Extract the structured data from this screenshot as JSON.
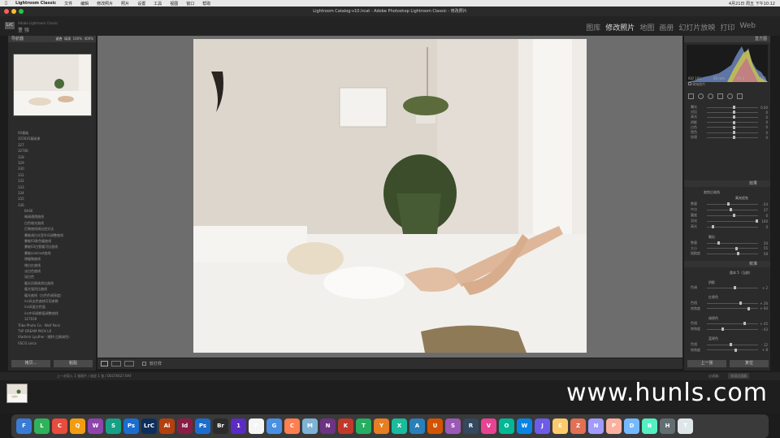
{
  "menubar": {
    "app": "Lightroom Classic",
    "items": [
      "文件",
      "编辑",
      "修改照片",
      "照片",
      "设置",
      "工具",
      "视图",
      "窗口",
      "帮助"
    ],
    "clock": "4月21日 周五 下午10:12"
  },
  "window_title": "Lightroom Catalog-v10.lrcat - Adobe Photoshop Lightroom Classic - 修改照片",
  "identity": {
    "logo": "LrC",
    "catalog": "Adobe Lightroom Classic",
    "user": "董 强"
  },
  "modules": {
    "items": [
      "图库",
      "修改照片",
      "地图",
      "画册",
      "幻灯片放映",
      "打印",
      "Web"
    ],
    "selected": "修改照片"
  },
  "left_panel": {
    "navigator": {
      "title": "导航器",
      "zoom": [
        "适合",
        "填满",
        "100%",
        "400%"
      ]
    },
    "presets": [
      "00基础",
      "325635基础课",
      "327",
      "32706",
      "328",
      "329",
      "330",
      "331",
      "332",
      "333",
      "334",
      "335",
      "336",
      "BASE",
      "暗调通透曲线",
      "白色暗光曲线",
      "巴黎曲线调出逆光法",
      "暴能调白光室外风调整曲线",
      "暴能03肤色暖曲线",
      "暴能03白皙暖可比曲线",
      "暴能contrast曲线",
      "增暖微曲线",
      "增白红曲线",
      "淡白色曲线",
      "深白色",
      "暖光风情咸邦比曲线",
      "暖光强烈比曲线",
      "暖光曲线（白色色调亮度）",
      "ins风去色曲线可用参数",
      "ins风复古色强",
      "ins中间调颜值调整曲线",
      "327039",
      "Tribe Photo Co - Wolf Pack",
      "TVP DREAM PACK LR",
      "Vladimir Lyuther（模特 后期调色）",
      "VSCO Leica"
    ],
    "buttons": {
      "copy": "拷贝...",
      "paste": "粘贴"
    }
  },
  "toolbar": {
    "softproof": "软打样"
  },
  "right_panel": {
    "histogram": {
      "title": "直方图",
      "iso": "ISO 100",
      "focal": "50 mm",
      "aperture": "f/1.8",
      "shutter": "1/125",
      "original": "原始照片"
    },
    "basic_sliders": [
      {
        "label": "曝光",
        "value": "0.00",
        "pos": 0.5
      },
      {
        "label": "对比",
        "value": "0",
        "pos": 0.5
      },
      {
        "label": "高光",
        "value": "0",
        "pos": 0.5
      },
      {
        "label": "阴影",
        "value": "0",
        "pos": 0.5
      },
      {
        "label": "白色",
        "value": "0",
        "pos": 0.5
      },
      {
        "label": "黑色",
        "value": "0",
        "pos": 0.5
      },
      {
        "label": "纹理",
        "value": "0",
        "pos": 0.5
      }
    ],
    "effects": {
      "title": "效果",
      "vignette_title": "裁剪后暗角",
      "style": "高光优先",
      "sliders": [
        {
          "label": "数量",
          "value": "-24",
          "pos": 0.4
        },
        {
          "label": "中点",
          "value": "37",
          "pos": 0.45
        },
        {
          "label": "圆度",
          "value": "0",
          "pos": 0.5
        },
        {
          "label": "羽化",
          "value": "100",
          "pos": 0.95
        },
        {
          "label": "高光",
          "value": "0",
          "pos": 0.1
        }
      ],
      "grain_title": "颗粒",
      "grain": [
        {
          "label": "数量",
          "value": "20",
          "pos": 0.2
        },
        {
          "label": "大小",
          "value": "55",
          "pos": 0.55
        },
        {
          "label": "粗糙度",
          "value": "58",
          "pos": 0.58
        }
      ]
    },
    "calibration": {
      "title": "校准",
      "process": "版本 5（当前）",
      "shadow_title": "阴影",
      "shadow": [
        {
          "label": "色调",
          "value": "+ 2",
          "pos": 0.52
        }
      ],
      "red_title": "红原色",
      "red": [
        {
          "label": "色相",
          "value": "+ 26",
          "pos": 0.63
        },
        {
          "label": "饱和度",
          "value": "+ 60",
          "pos": 0.8
        }
      ],
      "green_title": "绿原色",
      "green": [
        {
          "label": "色相",
          "value": "+ 45",
          "pos": 0.72
        },
        {
          "label": "饱和度",
          "value": "- 43",
          "pos": 0.28
        }
      ],
      "blue_title": "蓝原色",
      "blue": [
        {
          "label": "色相",
          "value": "- 12",
          "pos": 0.44
        },
        {
          "label": "饱和度",
          "value": "+ 8",
          "pos": 0.54
        }
      ]
    },
    "buttons": {
      "previous": "上一张",
      "reset": "复位"
    }
  },
  "filmstrip": {
    "info": "上一次导入  1 张照片 / 选定 1 张 / DSCF6627.RAF",
    "filter": "过滤器：",
    "filter_value": "关闭过滤器"
  },
  "watermark": "www.hunls.com",
  "dock": [
    "F",
    "L",
    "C",
    "Q",
    "W",
    "S",
    "Ps",
    "LrC",
    "Ai",
    "Id",
    "Ps",
    "Br",
    "1",
    "P",
    "G",
    "C",
    "M",
    "N",
    "K",
    "T",
    "Y",
    "X",
    "A",
    "U",
    "S",
    "R",
    "V",
    "O",
    "W",
    "J",
    "E",
    "Z",
    "N",
    "P",
    "D",
    "B",
    "H",
    "T"
  ],
  "colors": {
    "accent": "#d8d8d8",
    "panel": "#2b2b2b",
    "center": "#6d6d6d"
  }
}
